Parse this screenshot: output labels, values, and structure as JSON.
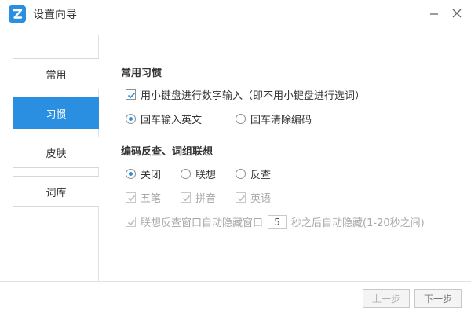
{
  "window": {
    "title": "设置向导",
    "logo_icon": "app-logo-z-icon",
    "minimize_icon": "minimize-icon",
    "close_icon": "close-icon",
    "accent_color": "#2a8fe0"
  },
  "sidebar": {
    "items": [
      {
        "label": "常用",
        "active": false
      },
      {
        "label": "习惯",
        "active": true
      },
      {
        "label": "皮肤",
        "active": false
      },
      {
        "label": "词库",
        "active": false
      }
    ]
  },
  "habits": {
    "title": "常用习惯",
    "numpad_digits": {
      "label": "用小键盘进行数字输入（即不用小键盘进行选词）",
      "checked": true
    },
    "enter_behavior": [
      {
        "label": "回车输入英文",
        "selected": true
      },
      {
        "label": "回车清除编码",
        "selected": false
      }
    ]
  },
  "reverse_lookup": {
    "title": "编码反查、词组联想",
    "mode_options": [
      {
        "label": "关闭",
        "selected": true
      },
      {
        "label": "联想",
        "selected": false
      },
      {
        "label": "反查",
        "selected": false
      }
    ],
    "sub_options": [
      {
        "label": "五笔",
        "checked": true,
        "enabled": false
      },
      {
        "label": "拼音",
        "checked": true,
        "enabled": false
      },
      {
        "label": "英语",
        "checked": true,
        "enabled": false
      }
    ],
    "auto_hide": {
      "label_before": "联想反查窗口自动隐藏窗口",
      "seconds": "5",
      "label_after": "秒之后自动隐藏(1-20秒之间)",
      "checked": true,
      "enabled": false
    }
  },
  "footer": {
    "prev_label": "上一步",
    "next_label": "下一步"
  }
}
